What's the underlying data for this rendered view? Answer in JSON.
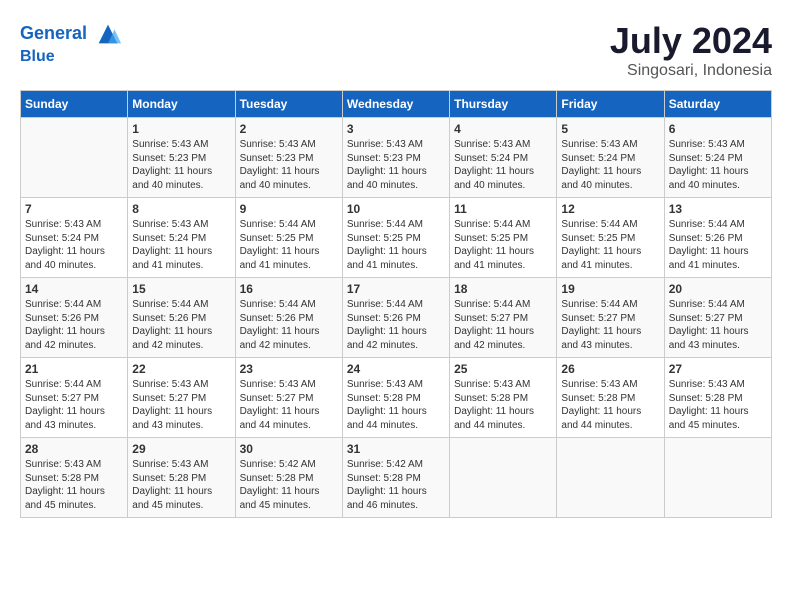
{
  "header": {
    "logo_line1": "General",
    "logo_line2": "Blue",
    "month_title": "July 2024",
    "location": "Singosari, Indonesia"
  },
  "weekdays": [
    "Sunday",
    "Monday",
    "Tuesday",
    "Wednesday",
    "Thursday",
    "Friday",
    "Saturday"
  ],
  "weeks": [
    [
      {
        "day": "",
        "info": ""
      },
      {
        "day": "1",
        "info": "Sunrise: 5:43 AM\nSunset: 5:23 PM\nDaylight: 11 hours\nand 40 minutes."
      },
      {
        "day": "2",
        "info": "Sunrise: 5:43 AM\nSunset: 5:23 PM\nDaylight: 11 hours\nand 40 minutes."
      },
      {
        "day": "3",
        "info": "Sunrise: 5:43 AM\nSunset: 5:23 PM\nDaylight: 11 hours\nand 40 minutes."
      },
      {
        "day": "4",
        "info": "Sunrise: 5:43 AM\nSunset: 5:24 PM\nDaylight: 11 hours\nand 40 minutes."
      },
      {
        "day": "5",
        "info": "Sunrise: 5:43 AM\nSunset: 5:24 PM\nDaylight: 11 hours\nand 40 minutes."
      },
      {
        "day": "6",
        "info": "Sunrise: 5:43 AM\nSunset: 5:24 PM\nDaylight: 11 hours\nand 40 minutes."
      }
    ],
    [
      {
        "day": "7",
        "info": "Sunrise: 5:43 AM\nSunset: 5:24 PM\nDaylight: 11 hours\nand 40 minutes."
      },
      {
        "day": "8",
        "info": "Sunrise: 5:43 AM\nSunset: 5:24 PM\nDaylight: 11 hours\nand 41 minutes."
      },
      {
        "day": "9",
        "info": "Sunrise: 5:44 AM\nSunset: 5:25 PM\nDaylight: 11 hours\nand 41 minutes."
      },
      {
        "day": "10",
        "info": "Sunrise: 5:44 AM\nSunset: 5:25 PM\nDaylight: 11 hours\nand 41 minutes."
      },
      {
        "day": "11",
        "info": "Sunrise: 5:44 AM\nSunset: 5:25 PM\nDaylight: 11 hours\nand 41 minutes."
      },
      {
        "day": "12",
        "info": "Sunrise: 5:44 AM\nSunset: 5:25 PM\nDaylight: 11 hours\nand 41 minutes."
      },
      {
        "day": "13",
        "info": "Sunrise: 5:44 AM\nSunset: 5:26 PM\nDaylight: 11 hours\nand 41 minutes."
      }
    ],
    [
      {
        "day": "14",
        "info": "Sunrise: 5:44 AM\nSunset: 5:26 PM\nDaylight: 11 hours\nand 42 minutes."
      },
      {
        "day": "15",
        "info": "Sunrise: 5:44 AM\nSunset: 5:26 PM\nDaylight: 11 hours\nand 42 minutes."
      },
      {
        "day": "16",
        "info": "Sunrise: 5:44 AM\nSunset: 5:26 PM\nDaylight: 11 hours\nand 42 minutes."
      },
      {
        "day": "17",
        "info": "Sunrise: 5:44 AM\nSunset: 5:26 PM\nDaylight: 11 hours\nand 42 minutes."
      },
      {
        "day": "18",
        "info": "Sunrise: 5:44 AM\nSunset: 5:27 PM\nDaylight: 11 hours\nand 42 minutes."
      },
      {
        "day": "19",
        "info": "Sunrise: 5:44 AM\nSunset: 5:27 PM\nDaylight: 11 hours\nand 43 minutes."
      },
      {
        "day": "20",
        "info": "Sunrise: 5:44 AM\nSunset: 5:27 PM\nDaylight: 11 hours\nand 43 minutes."
      }
    ],
    [
      {
        "day": "21",
        "info": "Sunrise: 5:44 AM\nSunset: 5:27 PM\nDaylight: 11 hours\nand 43 minutes."
      },
      {
        "day": "22",
        "info": "Sunrise: 5:43 AM\nSunset: 5:27 PM\nDaylight: 11 hours\nand 43 minutes."
      },
      {
        "day": "23",
        "info": "Sunrise: 5:43 AM\nSunset: 5:27 PM\nDaylight: 11 hours\nand 44 minutes."
      },
      {
        "day": "24",
        "info": "Sunrise: 5:43 AM\nSunset: 5:28 PM\nDaylight: 11 hours\nand 44 minutes."
      },
      {
        "day": "25",
        "info": "Sunrise: 5:43 AM\nSunset: 5:28 PM\nDaylight: 11 hours\nand 44 minutes."
      },
      {
        "day": "26",
        "info": "Sunrise: 5:43 AM\nSunset: 5:28 PM\nDaylight: 11 hours\nand 44 minutes."
      },
      {
        "day": "27",
        "info": "Sunrise: 5:43 AM\nSunset: 5:28 PM\nDaylight: 11 hours\nand 45 minutes."
      }
    ],
    [
      {
        "day": "28",
        "info": "Sunrise: 5:43 AM\nSunset: 5:28 PM\nDaylight: 11 hours\nand 45 minutes."
      },
      {
        "day": "29",
        "info": "Sunrise: 5:43 AM\nSunset: 5:28 PM\nDaylight: 11 hours\nand 45 minutes."
      },
      {
        "day": "30",
        "info": "Sunrise: 5:42 AM\nSunset: 5:28 PM\nDaylight: 11 hours\nand 45 minutes."
      },
      {
        "day": "31",
        "info": "Sunrise: 5:42 AM\nSunset: 5:28 PM\nDaylight: 11 hours\nand 46 minutes."
      },
      {
        "day": "",
        "info": ""
      },
      {
        "day": "",
        "info": ""
      },
      {
        "day": "",
        "info": ""
      }
    ]
  ]
}
